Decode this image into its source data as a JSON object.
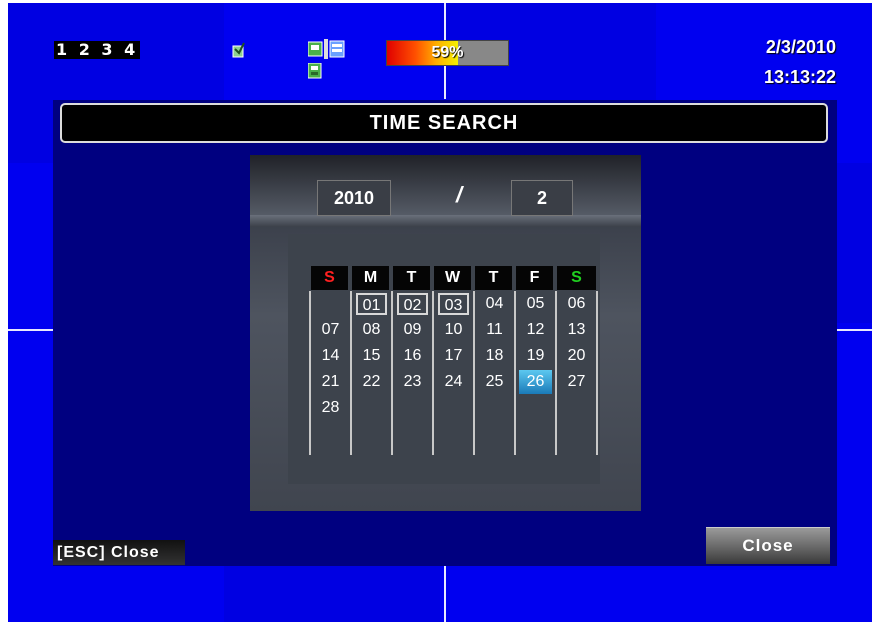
{
  "status_bar": {
    "channels": "1 2 3 4",
    "hdd_percent": 59,
    "hdd_label": "59%",
    "date": "2/3/2010",
    "time": "13:13:22",
    "icons": [
      "audio-icon",
      "network-icon",
      "disk-icon"
    ]
  },
  "dialog": {
    "title": "TIME SEARCH",
    "year": "2010",
    "separator": "/",
    "month": "2",
    "weekdays": [
      "S",
      "M",
      "T",
      "W",
      "T",
      "F",
      "S"
    ],
    "weekday_colors": [
      "#ff2020",
      "#ffffff",
      "#ffffff",
      "#ffffff",
      "#ffffff",
      "#ffffff",
      "#20d020"
    ],
    "weeks": [
      [
        "",
        "01",
        "02",
        "03",
        "04",
        "05",
        "06"
      ],
      [
        "07",
        "08",
        "09",
        "10",
        "11",
        "12",
        "13"
      ],
      [
        "14",
        "15",
        "16",
        "17",
        "18",
        "19",
        "20"
      ],
      [
        "21",
        "22",
        "23",
        "24",
        "25",
        "26",
        "27"
      ],
      [
        "28",
        "",
        "",
        "",
        "",
        "",
        ""
      ]
    ],
    "recorded_days": [
      "01",
      "02",
      "03"
    ],
    "selected_day": "26",
    "esc_hint": "[ESC] Close",
    "close_button": "Close"
  },
  "colors": {
    "background_blue": "#0000f0",
    "dialog_navy": "#000080",
    "selected_cell": "#3aa6e0"
  }
}
